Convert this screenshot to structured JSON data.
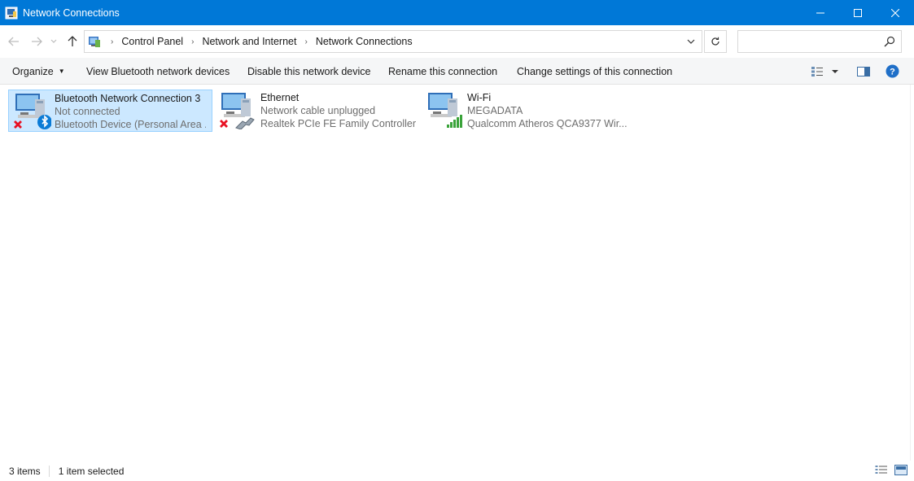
{
  "window": {
    "title": "Network Connections",
    "accent": "#0078d7"
  },
  "address": {
    "crumbs": [
      "Control Panel",
      "Network and Internet",
      "Network Connections"
    ],
    "search_placeholder": ""
  },
  "toolbar": {
    "organize": "Organize",
    "view_bluetooth": "View Bluetooth network devices",
    "disable_device": "Disable this network device",
    "rename": "Rename this connection",
    "change_settings": "Change settings of this connection"
  },
  "connections": [
    {
      "name": "Bluetooth Network Connection 3",
      "status": "Not connected",
      "device": "Bluetooth Device (Personal Area ...",
      "icon": "bluetooth-adapter-icon",
      "selected": true
    },
    {
      "name": "Ethernet",
      "status": "Network cable unplugged",
      "device": "Realtek PCIe FE Family Controller",
      "icon": "ethernet-adapter-icon",
      "selected": false
    },
    {
      "name": "Wi-Fi",
      "status": "MEGADATA",
      "device": "Qualcomm Atheros QCA9377 Wir...",
      "icon": "wifi-adapter-icon",
      "selected": false
    }
  ],
  "statusbar": {
    "count": "3 items",
    "selected": "1 item selected"
  }
}
